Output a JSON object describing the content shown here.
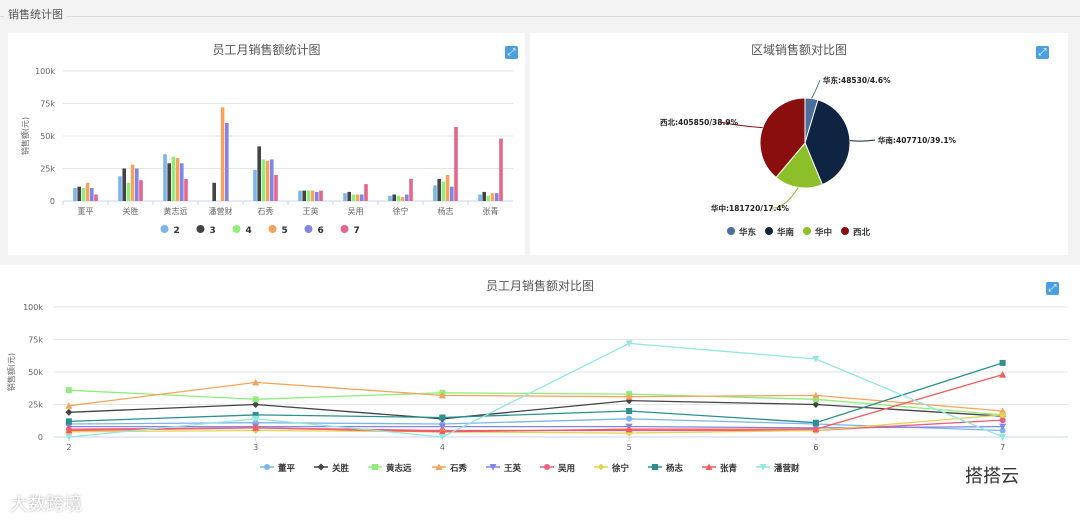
{
  "section": {
    "title": "销售统计图"
  },
  "bar_panel": {
    "title": "员工月销售额统计图",
    "expand_icon": "expand-icon"
  },
  "pie_panel": {
    "title": "区域销售额对比图",
    "expand_icon": "expand-icon"
  },
  "line_panel": {
    "title": "员工月销售额对比图",
    "expand_icon": "expand-icon"
  },
  "watermarks": {
    "left": "大数跨境",
    "right": "搭搭云"
  },
  "chart_data": [
    {
      "type": "bar",
      "title": "员工月销售额统计图",
      "ylabel": "销售额(元)",
      "ylim": [
        0,
        100000
      ],
      "yticks": [
        "0",
        "25k",
        "50k",
        "75k",
        "100k"
      ],
      "categories": [
        "董平",
        "关胜",
        "黄志远",
        "潘营财",
        "石秀",
        "王英",
        "吴用",
        "徐宁",
        "杨志",
        "张青"
      ],
      "legend_position": "bottom",
      "series": [
        {
          "name": "2",
          "color": "#7cb5ec",
          "values": [
            10000,
            19000,
            36000,
            0,
            24000,
            8000,
            6000,
            4000,
            12000,
            5000
          ]
        },
        {
          "name": "3",
          "color": "#434348",
          "values": [
            11000,
            25000,
            29000,
            14000,
            42000,
            8000,
            7000,
            5000,
            17000,
            7000
          ]
        },
        {
          "name": "4",
          "color": "#90ed7d",
          "values": [
            10000,
            14000,
            34000,
            0,
            32000,
            8000,
            5000,
            4000,
            15000,
            4000
          ]
        },
        {
          "name": "5",
          "color": "#f7a35c",
          "values": [
            14000,
            28000,
            33000,
            72000,
            31000,
            8000,
            5000,
            3000,
            20000,
            6000
          ]
        },
        {
          "name": "6",
          "color": "#8085e9",
          "values": [
            10000,
            25000,
            29000,
            60000,
            32000,
            7000,
            5000,
            5000,
            11000,
            6000
          ]
        },
        {
          "name": "7",
          "color": "#e4668a",
          "values": [
            5000,
            16000,
            17000,
            0,
            20000,
            8000,
            13000,
            17000,
            57000,
            48000
          ]
        }
      ]
    },
    {
      "type": "pie",
      "title": "区域销售额对比图",
      "legend_position": "bottom",
      "slices": [
        {
          "name": "华东",
          "value": 48530,
          "percent": "4.6%",
          "label": "华东:48530/4.6%",
          "color": "#4a6f9c"
        },
        {
          "name": "华南",
          "value": 407710,
          "percent": "39.1%",
          "label": "华南:407710/39.1%",
          "color": "#0f2442"
        },
        {
          "name": "华中",
          "value": 181720,
          "percent": "17.4%",
          "label": "华中:181720/17.4%",
          "color": "#8cbf2a"
        },
        {
          "name": "西北",
          "value": 405850,
          "percent": "38.9%",
          "label": "西北:405850/38.9%",
          "color": "#8b0e0e"
        }
      ]
    },
    {
      "type": "line",
      "title": "员工月销售额对比图",
      "ylabel": "销售额(元)",
      "ylim": [
        0,
        100000
      ],
      "yticks": [
        "0",
        "25k",
        "50k",
        "75k",
        "100k"
      ],
      "x": [
        2,
        3,
        4,
        5,
        6,
        7
      ],
      "legend_position": "bottom",
      "series": [
        {
          "name": "董平",
          "color": "#7cb5ec",
          "marker": "circle",
          "values": [
            10000,
            11000,
            10000,
            14000,
            10000,
            5000
          ]
        },
        {
          "name": "关胜",
          "color": "#434348",
          "marker": "diamond",
          "values": [
            19000,
            25000,
            14000,
            28000,
            25000,
            16000
          ]
        },
        {
          "name": "黄志远",
          "color": "#90ed7d",
          "marker": "square",
          "values": [
            36000,
            29000,
            34000,
            33000,
            29000,
            17000
          ]
        },
        {
          "name": "石秀",
          "color": "#f7a35c",
          "marker": "triangle",
          "values": [
            24000,
            42000,
            32000,
            31000,
            32000,
            20000
          ]
        },
        {
          "name": "王英",
          "color": "#8085e9",
          "marker": "triangle-down",
          "values": [
            8000,
            8000,
            8000,
            8000,
            7000,
            8000
          ]
        },
        {
          "name": "吴用",
          "color": "#f15c80",
          "marker": "circle",
          "values": [
            6000,
            7000,
            5000,
            5000,
            5000,
            13000
          ]
        },
        {
          "name": "徐宁",
          "color": "#e4d354",
          "marker": "diamond",
          "values": [
            4000,
            5000,
            4000,
            3000,
            5000,
            17000
          ]
        },
        {
          "name": "杨志",
          "color": "#2b908f",
          "marker": "square",
          "values": [
            12000,
            17000,
            15000,
            20000,
            11000,
            57000
          ]
        },
        {
          "name": "张青",
          "color": "#f45b5b",
          "marker": "triangle",
          "values": [
            5000,
            7000,
            4000,
            6000,
            6000,
            48000
          ]
        },
        {
          "name": "潘营财",
          "color": "#91e8e1",
          "marker": "triangle-down",
          "values": [
            0,
            14000,
            0,
            72000,
            60000,
            0
          ]
        }
      ]
    }
  ]
}
